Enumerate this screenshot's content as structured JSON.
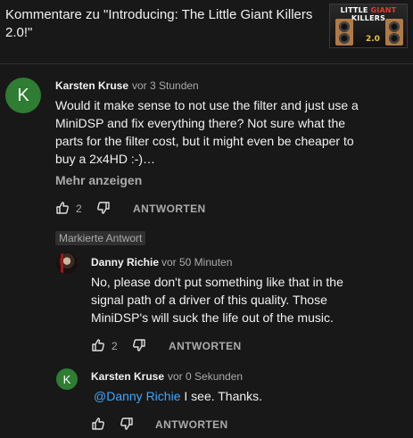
{
  "header": {
    "title": "Kommentare zu \"Introducing: The Little Giant Killers 2.0!\"",
    "thumbnail": {
      "title_part1": "LITTLE ",
      "title_part2": "GIANT",
      "title_part3": " KILLERS",
      "number": "2.0"
    }
  },
  "comment": {
    "avatar_letter": "K",
    "author": "Karsten Kruse",
    "time": "vor 3 Stunden",
    "text": "Would it make sense to not use the filter and just use a MiniDSP and fix everything there? Not sure what the parts for the filter cost, but it might even be cheaper to buy a 2x4HD :-)…",
    "more_label": "Mehr anzeigen",
    "like_count": "2",
    "reply_label": "ANTWORTEN"
  },
  "replies": {
    "badge": "Markierte Antwort",
    "reply1": {
      "author": "Danny Richie",
      "time": "vor 50 Minuten",
      "text": "No, please don't put something like that in the signal path of a driver of this quality. Those MiniDSP's will suck the life out of the music.",
      "like_count": "2",
      "reply_label": "ANTWORTEN"
    },
    "reply2": {
      "avatar_letter": "K",
      "author": "Karsten Kruse",
      "time": "vor 0 Sekunden",
      "mention": "@Danny Richie",
      "text": " I see. Thanks.",
      "reply_label": "ANTWORTEN"
    }
  },
  "colors": {
    "background": "#181818",
    "avatar_green": "#2e7d32",
    "mention_blue": "#3ea6ff",
    "secondary_text": "#aaaaaa"
  }
}
